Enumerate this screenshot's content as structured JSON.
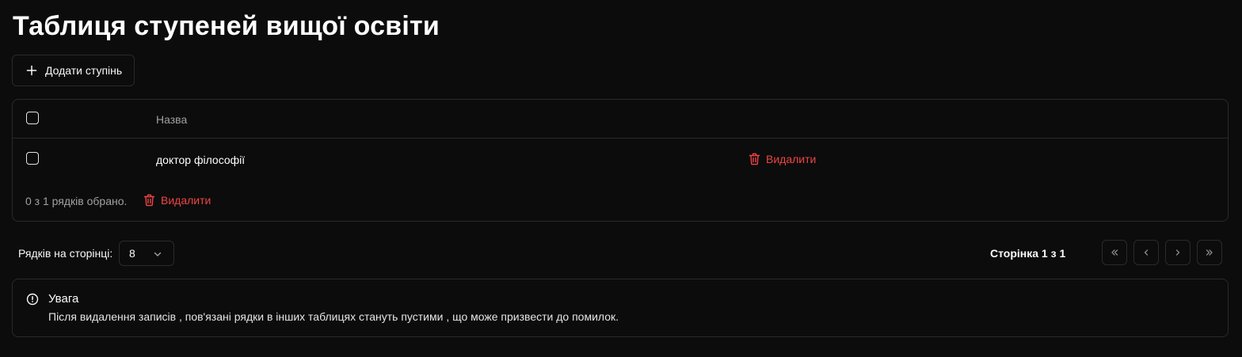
{
  "page": {
    "title": "Таблиця ступеней вищої освіти"
  },
  "toolbar": {
    "add_label": "Додати ступінь"
  },
  "table": {
    "columns": [
      "Назва"
    ],
    "rows": [
      {
        "name": "доктор філософії",
        "delete_label": "Видалити"
      }
    ],
    "selected_text": "0 з 1 рядків обрано.",
    "bulk_delete_label": "Видалити"
  },
  "pagination": {
    "rows_per_page_label": "Рядків на сторінці:",
    "rows_per_page_value": "8",
    "page_indicator": "Сторінка 1 з 1"
  },
  "alert": {
    "title": "Увага",
    "description": "Після видалення записів , пов'язані рядки в інших таблицях стануть пустими , що може призвести до помилок."
  },
  "colors": {
    "background": "#0c0c0c",
    "border": "#2a2a2a",
    "danger": "#ef4444",
    "muted_text": "#a1a1a1"
  },
  "icons": [
    "plus-icon",
    "trash-icon",
    "chevron-down-icon",
    "chevrons-left-icon",
    "chevron-left-icon",
    "chevron-right-icon",
    "chevrons-right-icon",
    "alert-circle-icon"
  ]
}
